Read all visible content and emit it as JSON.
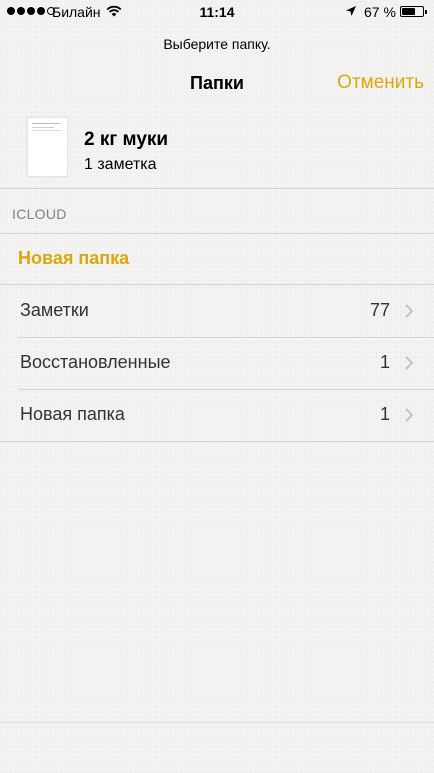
{
  "status_bar": {
    "carrier": "Билайн",
    "time": "11:14",
    "battery_percent": "67 %",
    "battery_level": 0.67,
    "signal_dots_filled": 4
  },
  "header": {
    "prompt": "Выберите папку.",
    "title": "Папки",
    "cancel_label": "Отменить"
  },
  "note": {
    "title": "2 кг муки",
    "count": "1 заметка"
  },
  "section": {
    "header": "ICLOUD",
    "new_folder_label": "Новая папка"
  },
  "folders": [
    {
      "label": "Заметки",
      "count": "77"
    },
    {
      "label": "Восстановленные",
      "count": "1"
    },
    {
      "label": "Новая папка",
      "count": "1"
    }
  ],
  "colors": {
    "accent": "#d9a70f",
    "background": "#f3f2f0",
    "separator": "#d4d3d1",
    "secondary_text": "#808080"
  }
}
